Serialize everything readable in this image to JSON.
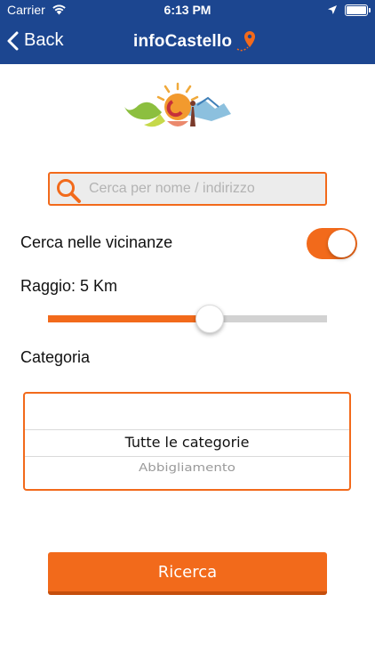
{
  "status_bar": {
    "carrier": "Carrier",
    "time": "6:13 PM"
  },
  "nav": {
    "back_label": "Back",
    "brand_prefix": "info",
    "brand_name": "Castello",
    "color": "#1c4690"
  },
  "search": {
    "placeholder": "Cerca per nome / indirizzo",
    "value": ""
  },
  "nearby": {
    "label": "Cerca nelle vicinanze",
    "enabled": true
  },
  "radius": {
    "label": "Raggio: 5 Km",
    "fraction": 0.58
  },
  "category": {
    "label": "Categoria",
    "selected": "Tutte le categorie",
    "next_option": "Abbigliamento"
  },
  "search_button": {
    "label": "Ricerca"
  },
  "colors": {
    "accent": "#f26a1b",
    "header": "#1c4690"
  }
}
